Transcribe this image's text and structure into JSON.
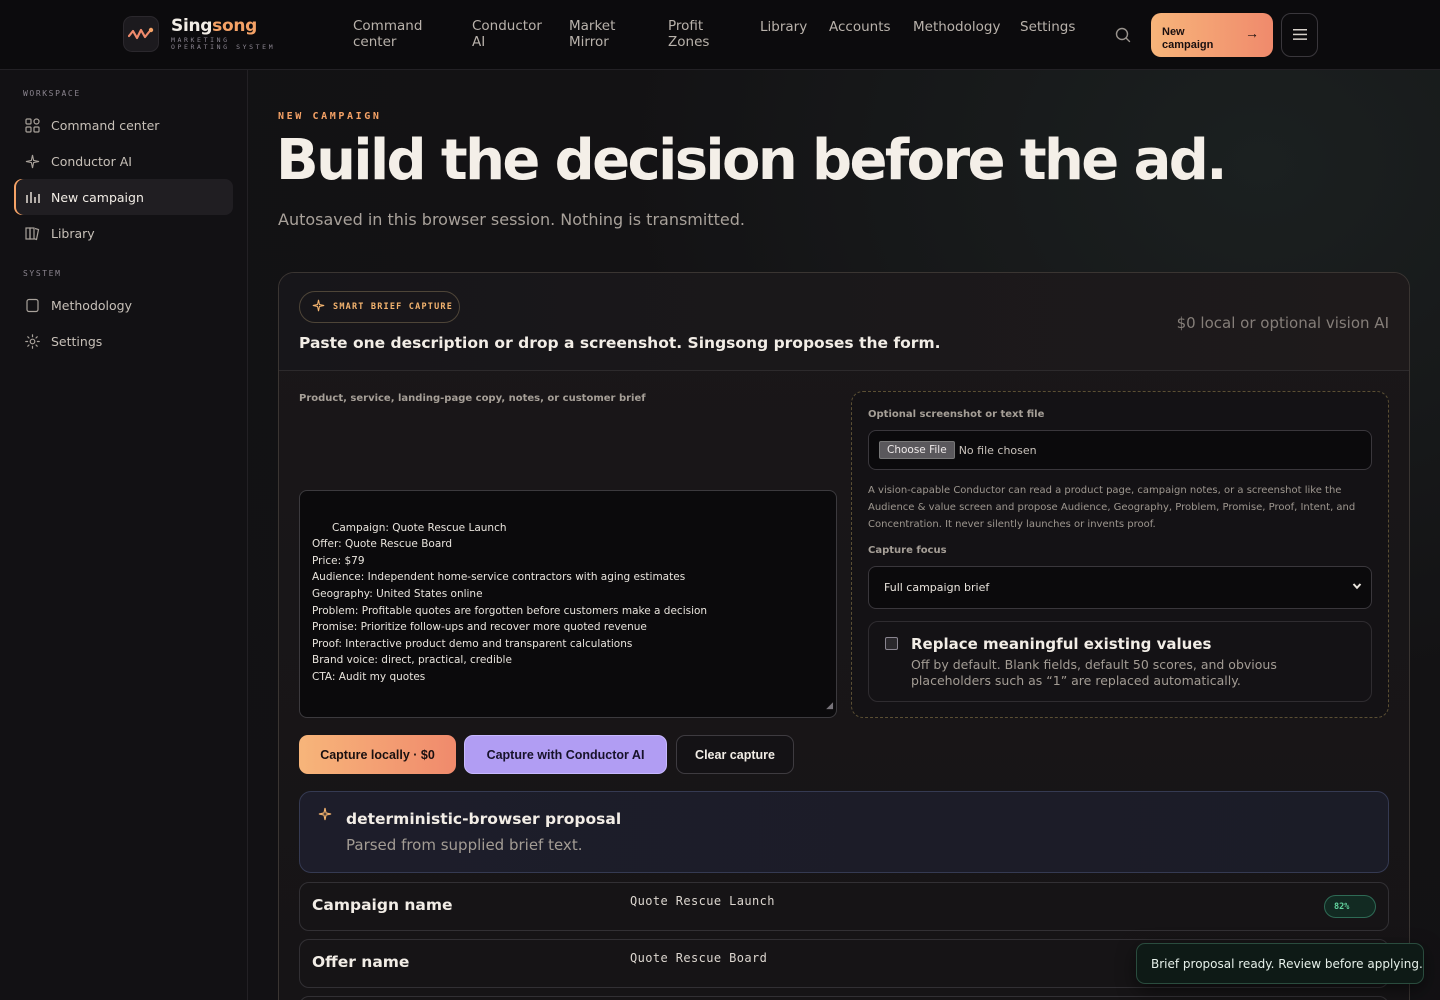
{
  "brand": {
    "name_a": "Sing",
    "name_b": "song",
    "tagline": "MARKETING OPERATING SYSTEM"
  },
  "nav": {
    "items": [
      "Command center",
      "Conductor AI",
      "Market Mirror",
      "Profit Zones",
      "Library",
      "Accounts",
      "Methodology",
      "Settings"
    ],
    "cta_label": "New campaign",
    "cta_icon": "arrow-right-icon",
    "search_icon": "search-icon",
    "menu_icon": "hamburger-icon"
  },
  "sidebar": {
    "workspace_heading": "WORKSPACE",
    "workspace_items": [
      {
        "label": "Command center",
        "icon": "grid-icon"
      },
      {
        "label": "Conductor AI",
        "icon": "sparkle-icon"
      },
      {
        "label": "New campaign",
        "icon": "bar-chart-icon",
        "active": true
      },
      {
        "label": "Library",
        "icon": "book-icon"
      }
    ],
    "system_heading": "SYSTEM",
    "system_items": [
      {
        "label": "Methodology",
        "icon": "doc-icon"
      },
      {
        "label": "Settings",
        "icon": "gear-icon"
      }
    ]
  },
  "page": {
    "eyebrow": "NEW CAMPAIGN",
    "title": "Build the decision before the ad.",
    "subtitle": "Autosaved in this browser session. Nothing is transmitted."
  },
  "capture": {
    "pill_label": "SMART BRIEF CAPTURE",
    "title": "Paste one description or drop a screenshot. Singsong proposes the form.",
    "cost_note": "$0 local or optional vision AI",
    "brief_label": "Product, service, landing-page copy, notes, or customer brief",
    "brief_text": "Campaign: Quote Rescue Launch\nOffer: Quote Rescue Board\nPrice: $79\nAudience: Independent home-service contractors with aging estimates\nGeography: United States online\nProblem: Profitable quotes are forgotten before customers make a decision\nPromise: Prioritize follow-ups and recover more quoted revenue\nProof: Interactive product demo and transparent calculations\nBrand voice: direct, practical, credible\nCTA: Audit my quotes",
    "file_label": "Optional screenshot or text file",
    "file_button": "Choose File",
    "file_status": "No file chosen",
    "file_description": "A vision-capable Conductor can read a product page, campaign notes, or a screenshot like the Audience & value screen and propose Audience, Geography, Problem, Promise, Proof, Intent, and Concentration. It never silently launches or invents proof.",
    "focus_label": "Capture focus",
    "focus_value": "Full campaign brief",
    "replace_title": "Replace meaningful existing values",
    "replace_desc": "Off by default. Blank fields, default 50 scores, and obvious placeholders such as “1” are replaced automatically.",
    "replace_checked": false,
    "btn_local": "Capture locally · $0",
    "btn_ai": "Capture with Conductor AI",
    "btn_clear": "Clear capture"
  },
  "proposal": {
    "title": "deterministic-browser proposal",
    "description": "Parsed from supplied brief text."
  },
  "fields": [
    {
      "name": "Campaign name",
      "value": "Quote Rescue Launch",
      "confidence": "82%"
    },
    {
      "name": "Offer name",
      "value": "Quote Rescue Board"
    }
  ],
  "toast": {
    "message": "Brief proposal ready. Review before applying."
  },
  "colors": {
    "accent": "#f5a266",
    "ai_button": "#b19df3",
    "confidence": "#62d39e"
  }
}
